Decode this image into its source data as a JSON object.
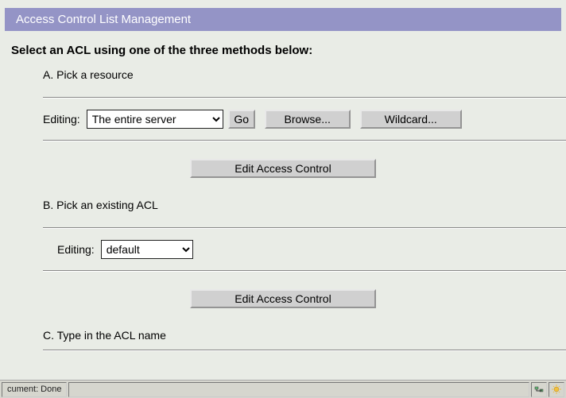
{
  "header": {
    "title": "Access Control List Management"
  },
  "subheading": "Select an ACL using one of the three methods below:",
  "sectionA": {
    "label": "A. Pick a resource",
    "editing_label": "Editing:",
    "editing_value": "The entire server",
    "go_label": "Go",
    "browse_label": "Browse...",
    "wildcard_label": "Wildcard...",
    "edit_label": "Edit Access Control"
  },
  "sectionB": {
    "label": "B. Pick an existing ACL",
    "editing_label": "Editing:",
    "editing_value": "default",
    "edit_label": "Edit Access Control"
  },
  "sectionC": {
    "label": "C. Type in the ACL name"
  },
  "statusbar": {
    "text": "cument: Done"
  }
}
